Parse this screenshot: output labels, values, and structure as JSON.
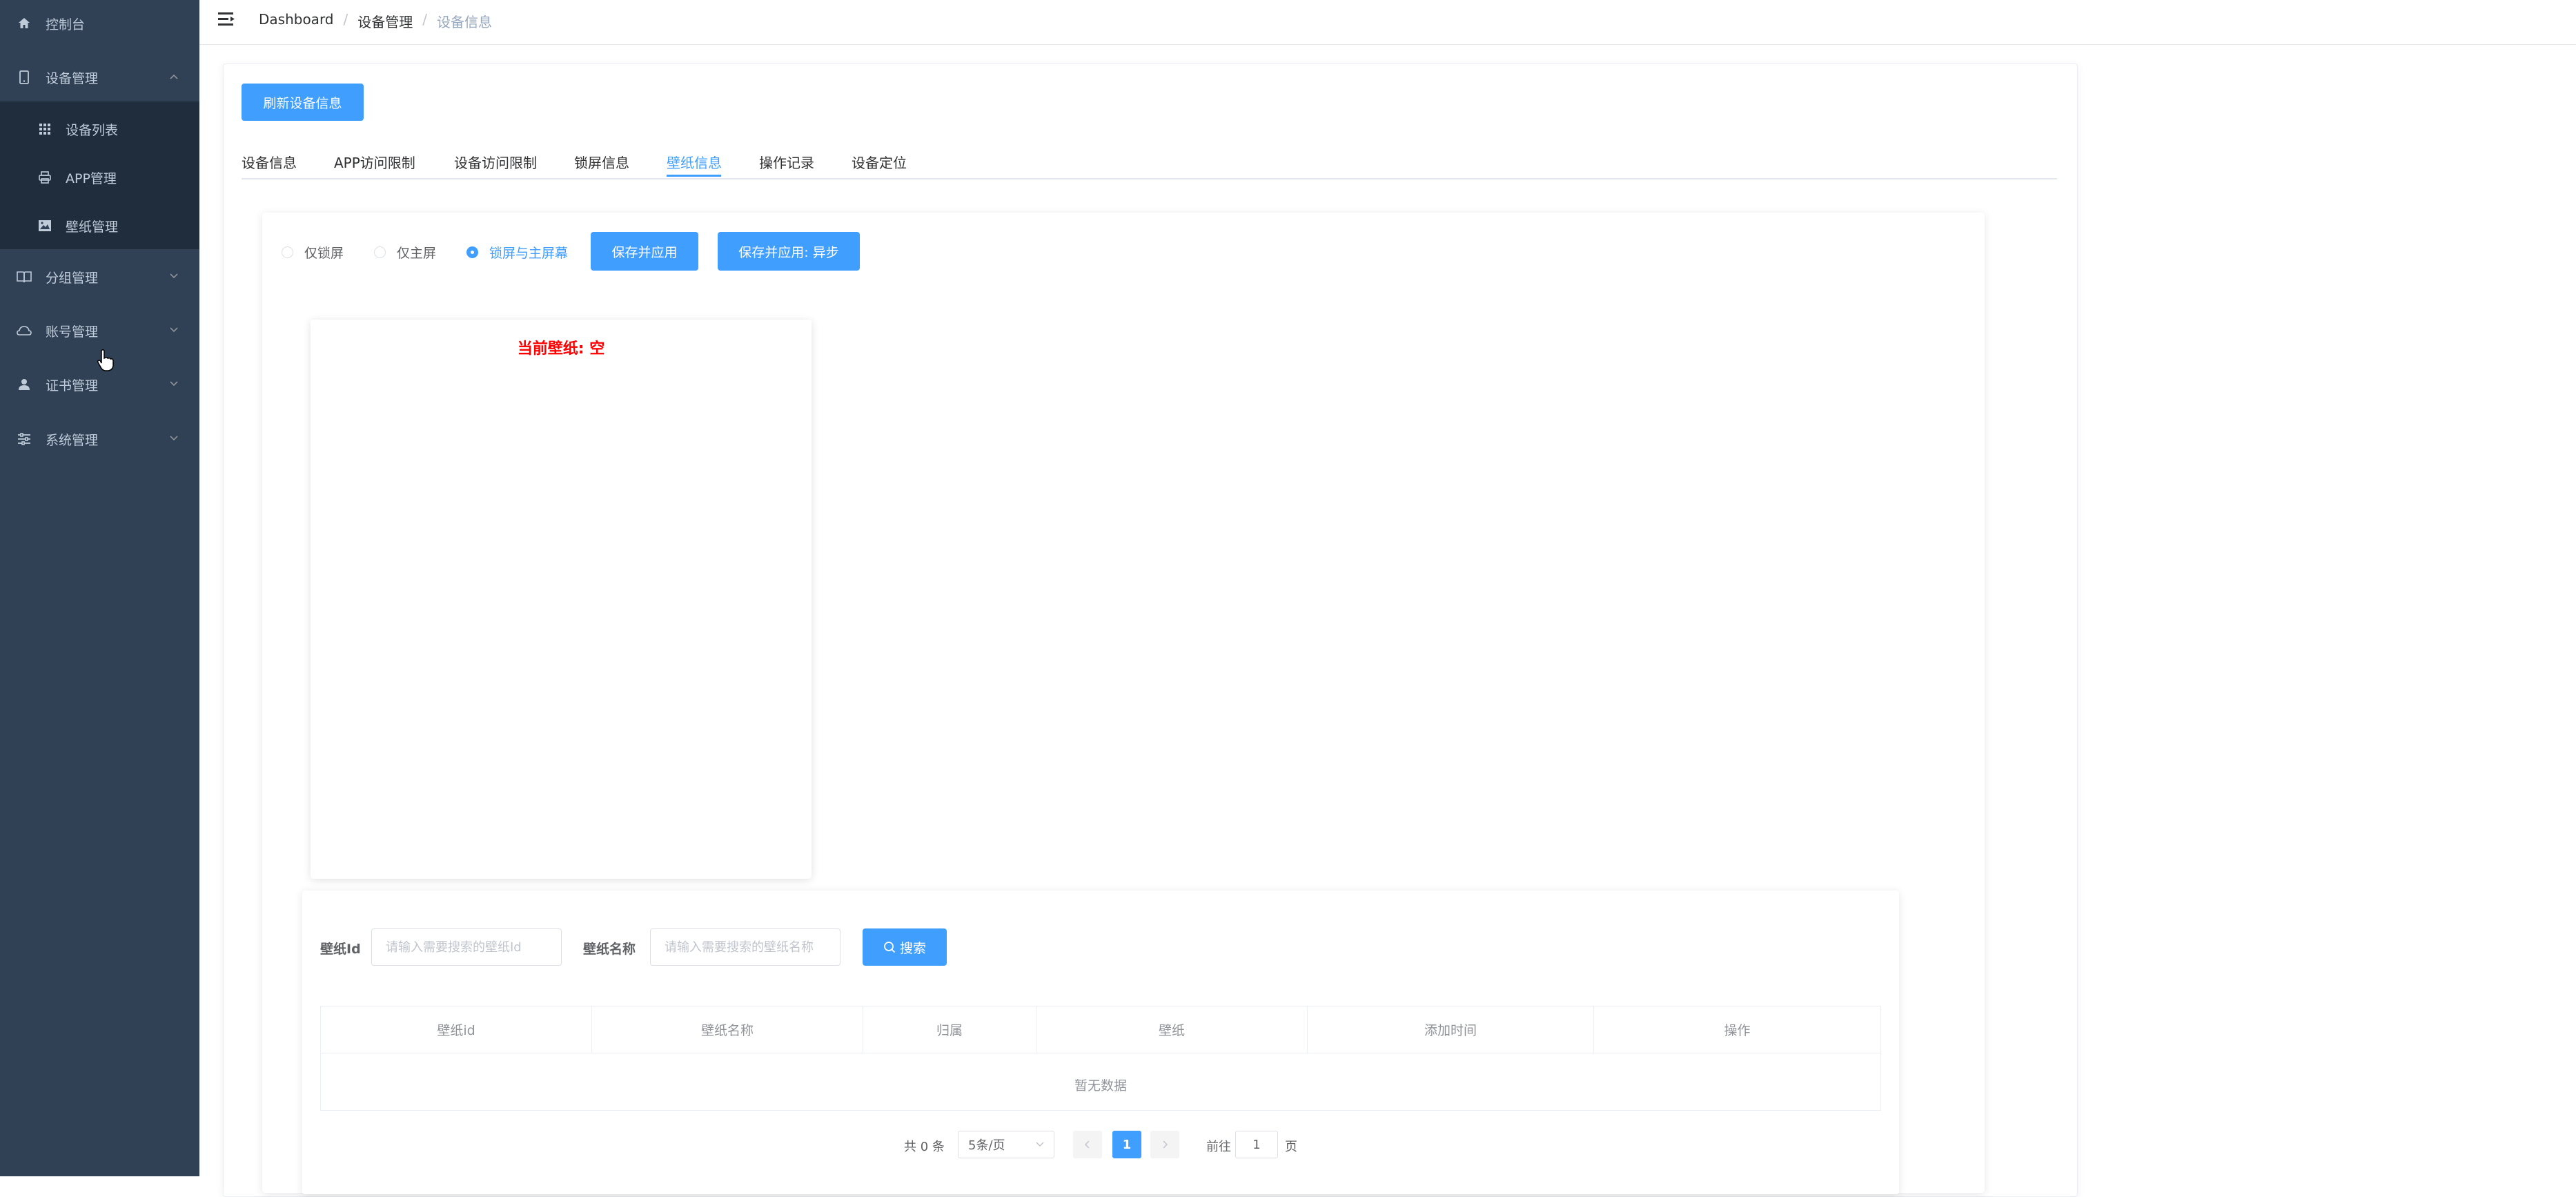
{
  "sidebar": {
    "items": [
      {
        "label": "控制台",
        "icon": "home-icon"
      },
      {
        "label": "设备管理",
        "icon": "tablet-icon",
        "expanded": true
      },
      {
        "label": "分组管理",
        "icon": "book-icon"
      },
      {
        "label": "账号管理",
        "icon": "cloud-icon"
      },
      {
        "label": "证书管理",
        "icon": "user-icon"
      },
      {
        "label": "系统管理",
        "icon": "sliders-icon"
      }
    ],
    "subitems": [
      {
        "label": "设备列表",
        "icon": "grid-icon"
      },
      {
        "label": "APP管理",
        "icon": "printer-icon"
      },
      {
        "label": "壁纸管理",
        "icon": "picture-icon"
      }
    ]
  },
  "breadcrumb": {
    "home": "Dashboard",
    "parent": "设备管理",
    "current": "设备信息",
    "separator": "/"
  },
  "refresh_button": "刷新设备信息",
  "tabs": [
    "设备信息",
    "APP访问限制",
    "设备访问限制",
    "锁屏信息",
    "壁纸信息",
    "操作记录",
    "设备定位"
  ],
  "active_tab": "壁纸信息",
  "wallpaper_mode": {
    "options": [
      "仅锁屏",
      "仅主屏",
      "锁屏与主屏幕"
    ],
    "selected": "锁屏与主屏幕"
  },
  "save_apply_button": "保存并应用",
  "save_apply_async_button": "保存并应用: 异步",
  "current_wallpaper": "当前壁纸: 空",
  "search": {
    "id_label": "壁纸Id",
    "id_placeholder": "请输入需要搜索的壁纸Id",
    "name_label": "壁纸名称",
    "name_placeholder": "请输入需要搜索的壁纸名称",
    "button": "搜索"
  },
  "table": {
    "columns": [
      "壁纸id",
      "壁纸名称",
      "归属",
      "壁纸",
      "添加时间",
      "操作"
    ],
    "empty_text": "暂无数据"
  },
  "pagination": {
    "total": "共 0 条",
    "page_size": "5条/页",
    "current_page": "1",
    "goto_label": "前往",
    "goto_value": "1",
    "page_suffix": "页"
  },
  "colors": {
    "sidebar_bg": "#304156",
    "accent": "#409eff",
    "warning": "#ff0000"
  }
}
